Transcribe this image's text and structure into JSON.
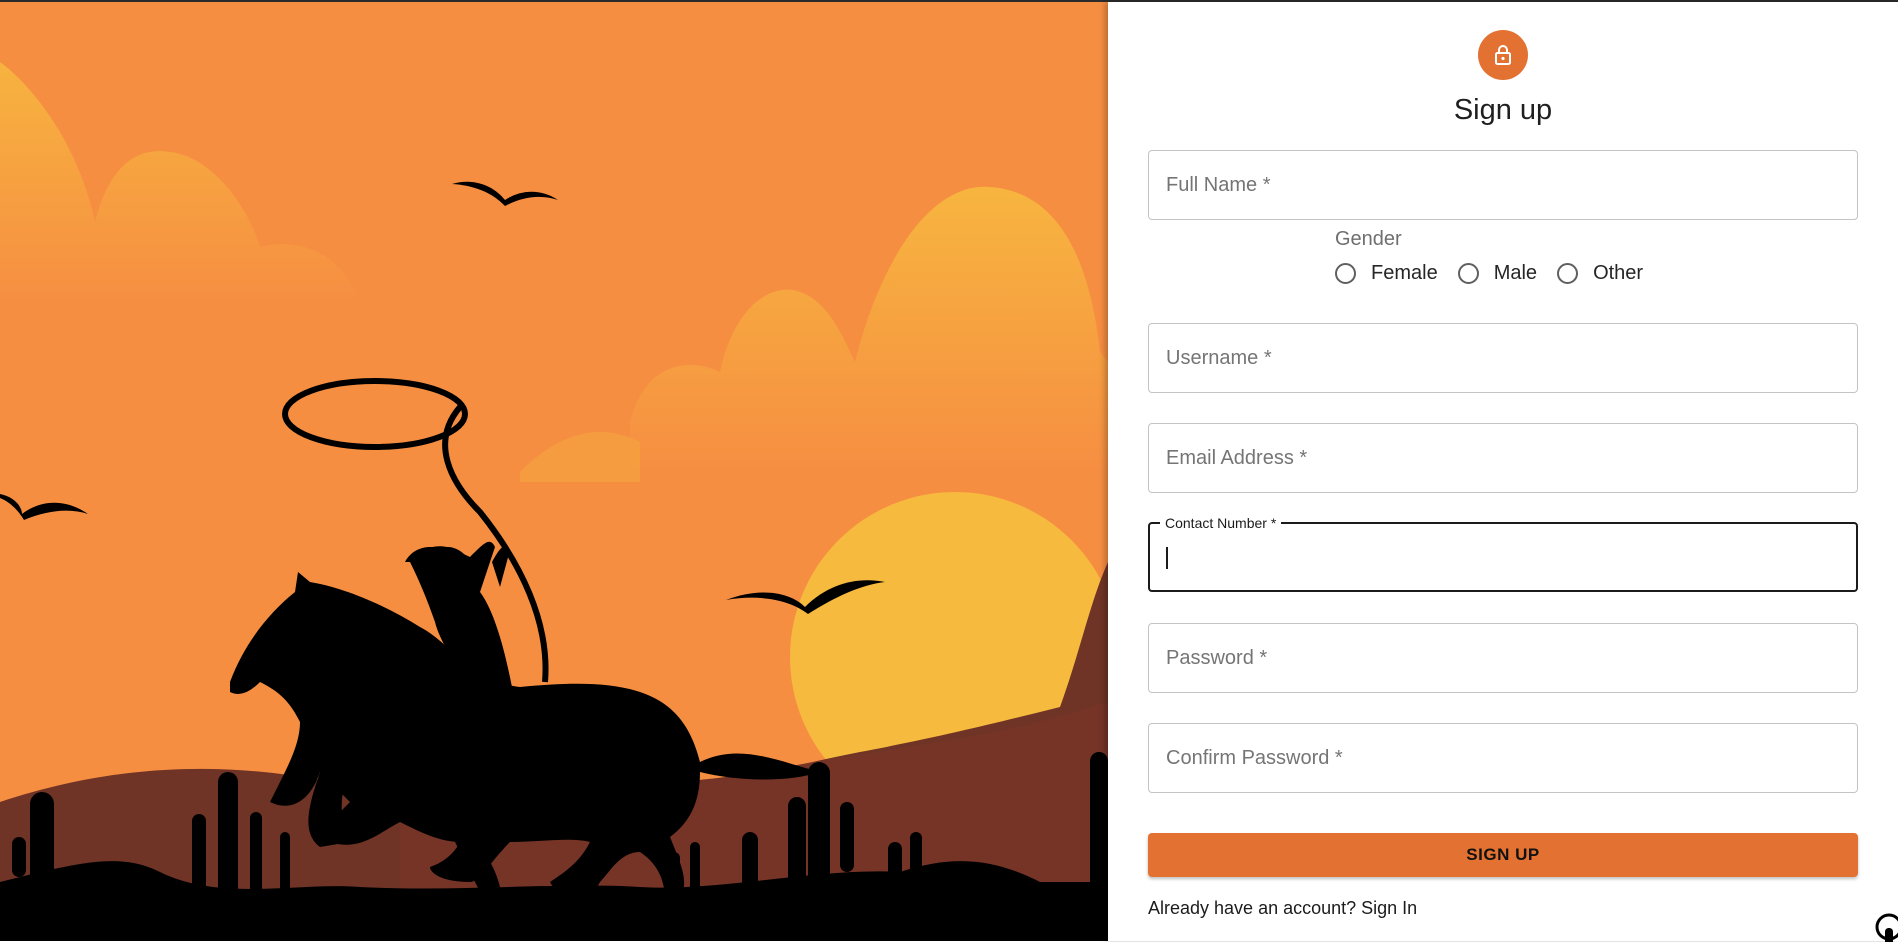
{
  "form": {
    "title": "Sign up",
    "full_name_placeholder": "Full Name *",
    "gender_label": "Gender",
    "gender_options": [
      "Female",
      "Male",
      "Other"
    ],
    "username_placeholder": "Username *",
    "email_placeholder": "Email Address *",
    "contact_label": "Contact Number *",
    "password_placeholder": "Password *",
    "confirm_password_placeholder": "Confirm Password *",
    "submit_label": "SIGN UP",
    "signin_prompt": "Already have an account? Sign In"
  },
  "colors": {
    "accent": "#e37232",
    "sky": "#f68e42",
    "sun": "#f6ba3e",
    "hills": "#6f3425"
  },
  "icons": {
    "avatar": "lock-icon",
    "corner": "github-icon"
  }
}
